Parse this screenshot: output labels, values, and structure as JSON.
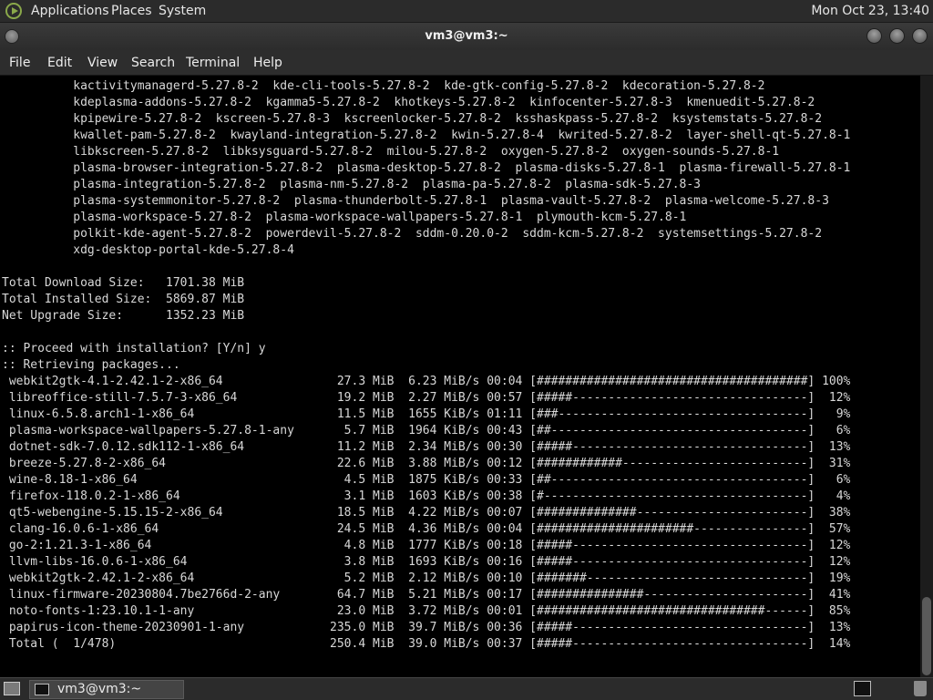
{
  "top_panel": {
    "menus": [
      "Applications",
      "Places",
      "System"
    ],
    "clock": "Mon Oct 23, 13:40"
  },
  "window": {
    "title": "vm3@vm3:~"
  },
  "menu_bar": [
    "File",
    "Edit",
    "View",
    "Search",
    "Terminal",
    "Help"
  ],
  "terminal_lines": [
    "          kactivitymanagerd-5.27.8-2  kde-cli-tools-5.27.8-2  kde-gtk-config-5.27.8-2  kdecoration-5.27.8-2",
    "          kdeplasma-addons-5.27.8-2  kgamma5-5.27.8-2  khotkeys-5.27.8-2  kinfocenter-5.27.8-3  kmenuedit-5.27.8-2",
    "          kpipewire-5.27.8-2  kscreen-5.27.8-3  kscreenlocker-5.27.8-2  ksshaskpass-5.27.8-2  ksystemstats-5.27.8-2",
    "          kwallet-pam-5.27.8-2  kwayland-integration-5.27.8-2  kwin-5.27.8-4  kwrited-5.27.8-2  layer-shell-qt-5.27.8-1",
    "          libkscreen-5.27.8-2  libksysguard-5.27.8-2  milou-5.27.8-2  oxygen-5.27.8-2  oxygen-sounds-5.27.8-1",
    "          plasma-browser-integration-5.27.8-2  plasma-desktop-5.27.8-2  plasma-disks-5.27.8-1  plasma-firewall-5.27.8-1",
    "          plasma-integration-5.27.8-2  plasma-nm-5.27.8-2  plasma-pa-5.27.8-2  plasma-sdk-5.27.8-3",
    "          plasma-systemmonitor-5.27.8-2  plasma-thunderbolt-5.27.8-1  plasma-vault-5.27.8-2  plasma-welcome-5.27.8-3",
    "          plasma-workspace-5.27.8-2  plasma-workspace-wallpapers-5.27.8-1  plymouth-kcm-5.27.8-1",
    "          polkit-kde-agent-5.27.8-2  powerdevil-5.27.8-2  sddm-0.20.0-2  sddm-kcm-5.27.8-2  systemsettings-5.27.8-2",
    "          xdg-desktop-portal-kde-5.27.8-4",
    "",
    "Total Download Size:   1701.38 MiB",
    "Total Installed Size:  5869.87 MiB",
    "Net Upgrade Size:      1352.23 MiB",
    "",
    ":: Proceed with installation? [Y/n] y",
    ":: Retrieving packages...",
    " webkit2gtk-4.1-2.42.1-2-x86_64                27.3 MiB  6.23 MiB/s 00:04 [######################################] 100%",
    " libreoffice-still-7.5.7-3-x86_64              19.2 MiB  2.27 MiB/s 00:57 [#####---------------------------------]  12%",
    " linux-6.5.8.arch1-1-x86_64                    11.5 MiB  1655 KiB/s 01:11 [###-----------------------------------]   9%",
    " plasma-workspace-wallpapers-5.27.8-1-any       5.7 MiB  1964 KiB/s 00:43 [##------------------------------------]   6%",
    " dotnet-sdk-7.0.12.sdk112-1-x86_64             11.2 MiB  2.34 MiB/s 00:30 [#####---------------------------------]  13%",
    " breeze-5.27.8-2-x86_64                        22.6 MiB  3.88 MiB/s 00:12 [############--------------------------]  31%",
    " wine-8.18-1-x86_64                             4.5 MiB  1875 KiB/s 00:33 [##------------------------------------]   6%",
    " firefox-118.0.2-1-x86_64                       3.1 MiB  1603 KiB/s 00:38 [#-------------------------------------]   4%",
    " qt5-webengine-5.15.15-2-x86_64                18.5 MiB  4.22 MiB/s 00:07 [##############------------------------]  38%",
    " clang-16.0.6-1-x86_64                         24.5 MiB  4.36 MiB/s 00:04 [######################----------------]  57%",
    " go-2:1.21.3-1-x86_64                           4.8 MiB  1777 KiB/s 00:18 [#####---------------------------------]  12%",
    " llvm-libs-16.0.6-1-x86_64                      3.8 MiB  1693 KiB/s 00:16 [#####---------------------------------]  12%",
    " webkit2gtk-2.42.1-2-x86_64                     5.2 MiB  2.12 MiB/s 00:10 [#######-------------------------------]  19%",
    " linux-firmware-20230804.7be2766d-2-any        64.7 MiB  5.21 MiB/s 00:17 [###############-----------------------]  41%",
    " noto-fonts-1:23.10.1-1-any                    23.0 MiB  3.72 MiB/s 00:01 [################################------]  85%",
    " papirus-icon-theme-20230901-1-any            235.0 MiB  39.7 MiB/s 00:36 [#####---------------------------------]  13%",
    " Total (  1/478)                              250.4 MiB  39.0 MiB/s 00:37 [#####---------------------------------]  14%"
  ],
  "taskbar": {
    "task_label": "vm3@vm3:~"
  },
  "icons": {
    "top_logo": "menu-logo-icon",
    "window_menu": "window-menu-icon",
    "show_desktop": "show-desktop-icon",
    "task": "terminal-icon",
    "tray": "terminal-icon",
    "trash": "trash-icon"
  }
}
